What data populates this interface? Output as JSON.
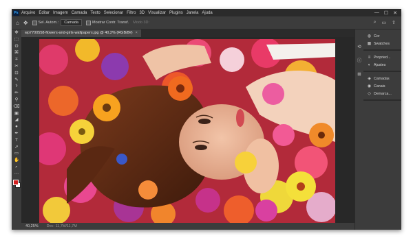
{
  "app": {
    "logo": "Ps"
  },
  "menu": [
    "Arquivo",
    "Editar",
    "Imagem",
    "Camada",
    "Texto",
    "Selecionar",
    "Filtro",
    "3D",
    "Visualizar",
    "Plugins",
    "Janela",
    "Ajuda"
  ],
  "window_controls": {
    "minimize": "—",
    "maximize": "☐",
    "close": "✕"
  },
  "options_bar": {
    "home": "⌂",
    "move": "✥",
    "auto_select": "Sel. Autom.:",
    "layer_dropdown": "Camada",
    "show_transform": "Mostrar Contr. Transf.",
    "mode3d": "Modo 3D:",
    "right_icons": [
      "⌕",
      "▭",
      "⇪"
    ]
  },
  "tools": [
    "✥",
    "⬚",
    "ʘ",
    "⌘",
    "⌗",
    "✂",
    "⊡",
    "✎",
    "⚕",
    "✏",
    "⚲",
    "⌫",
    "▣",
    "◢",
    "●",
    "✒",
    "T",
    "➚",
    "▭",
    "✋",
    "⌕",
    "⋯"
  ],
  "colors": {
    "foreground": "#d41f1f",
    "background": "#ffffff"
  },
  "document": {
    "tab_title": "wp7700558-flowers-and-girls-wallpapers.jpg @ 40,2% (RGB/8#)",
    "close": "×"
  },
  "status": {
    "zoom": "40,25%",
    "doc": "Doc: 11,7M/11,7M"
  },
  "icon_strip": [
    "⟲",
    "ⓘ",
    "⊞"
  ],
  "panels": [
    {
      "items": [
        {
          "icon": "◍",
          "label": "Cor"
        },
        {
          "icon": "▦",
          "label": "Swatches"
        }
      ]
    },
    {
      "items": [
        {
          "icon": "≡",
          "label": "Propried..."
        },
        {
          "icon": "◐",
          "label": "Ajustes"
        }
      ]
    },
    {
      "items": [
        {
          "icon": "◈",
          "label": "Camadas"
        },
        {
          "icon": "◉",
          "label": "Canais"
        },
        {
          "icon": "◇",
          "label": "Demarca..."
        }
      ]
    }
  ]
}
